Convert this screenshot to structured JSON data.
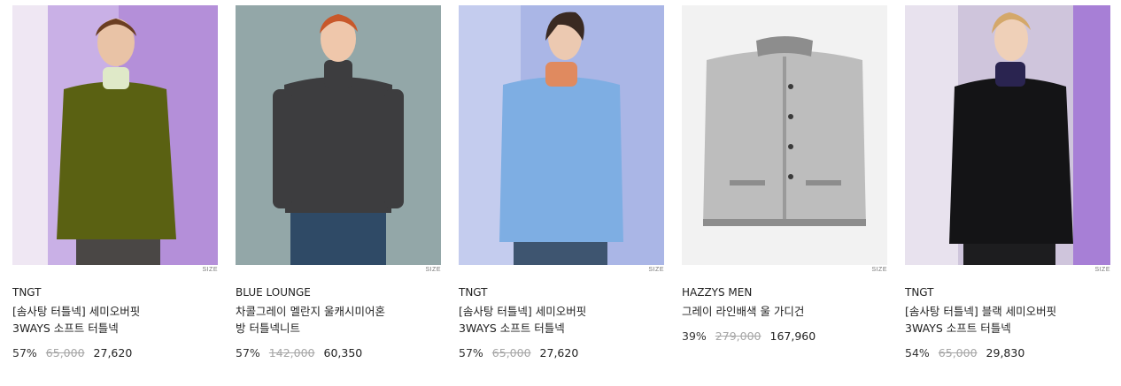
{
  "products": [
    {
      "brand": "TNGT",
      "name_line1": "[솜사탕 터틀넥] 세미오버핏",
      "name_line2": "3WAYS 소프트 터틀넥",
      "discount": "57%",
      "original_price": "65,000",
      "price": "27,620",
      "size_label": "SIZE",
      "image": {
        "bg": "#b48fd9",
        "top": "#5a6112",
        "collar": "#dfe9c8",
        "pants": "#4a4745",
        "hair": "#6b3e22"
      }
    },
    {
      "brand": "BLUE LOUNGE",
      "name_line1": "차콜그레이 멜란지 울캐시미어혼",
      "name_line2": "방 터틀넥니트",
      "discount": "57%",
      "original_price": "142,000",
      "price": "60,350",
      "size_label": "SIZE",
      "image": {
        "bg": "#93a7a8",
        "top": "#3d3d3f",
        "collar": "#3d3d3f",
        "pants": "#2f4a66",
        "hair": "#c8582a"
      }
    },
    {
      "brand": "TNGT",
      "name_line1": "[솜사탕 터틀넥] 세미오버핏",
      "name_line2": "3WAYS 소프트 터틀넥",
      "discount": "57%",
      "original_price": "65,000",
      "price": "27,620",
      "size_label": "SIZE",
      "image": {
        "bg": "#aab6e6",
        "top": "#7eaee3",
        "collar": "#e08a5f",
        "pants": "#3e5570",
        "hair": "#3a2a22"
      }
    },
    {
      "brand": "HAZZYS MEN",
      "name_line1": "그레이 라인배색 울 가디건",
      "name_line2": "",
      "discount": "39%",
      "original_price": "279,000",
      "price": "167,960",
      "size_label": "SIZE",
      "image": {
        "bg": "#f2f2f2",
        "top": "#bdbdbd",
        "collar": "#8d8d8d",
        "pants": "#f2f2f2",
        "hair": "#f2f2f2"
      }
    },
    {
      "brand": "TNGT",
      "name_line1": "[솜사탕 터틀넥] 블랙 세미오버핏",
      "name_line2": "3WAYS 소프트 터틀넥",
      "discount": "54%",
      "original_price": "65,000",
      "price": "29,830",
      "size_label": "SIZE",
      "image": {
        "bg": "#9a8fb0",
        "top": "#141416",
        "collar": "#2a2450",
        "pants": "#1d1d1f",
        "hair": "#d4a86a"
      }
    }
  ]
}
